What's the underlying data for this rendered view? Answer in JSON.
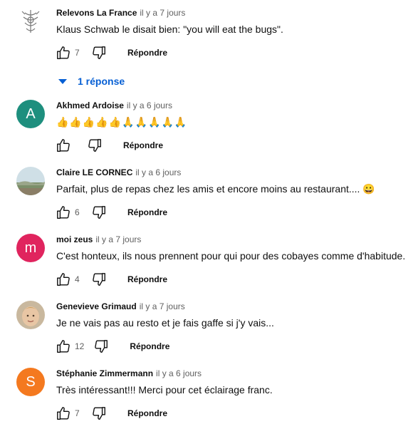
{
  "colors": {
    "link": "#065fd4",
    "avatar_a": "#1e8f7e",
    "avatar_m": "#e0245e",
    "avatar_s": "#f4791f"
  },
  "reply_label": "Répondre",
  "comments": [
    {
      "author": "Relevons La France",
      "time": "il y a 7 jours",
      "text": "Klaus Schwab le disait bien: \"you will eat the bugs\".",
      "likes": "7",
      "replies_label": "1 réponse"
    },
    {
      "author": "Akhmed Ardoise",
      "avatar_letter": "A",
      "time": "il y a 6 jours",
      "text": "👍👍👍👍👍🙏🙏🙏🙏🙏",
      "likes": ""
    },
    {
      "author": "Claire LE CORNEC",
      "time": "il y a 6 jours",
      "text": "Parfait, plus de repas chez les amis et encore moins au restaurant.... 😀",
      "likes": "6"
    },
    {
      "author": "moi zeus",
      "avatar_letter": "m",
      "time": "il y a 7 jours",
      "text": "C'est honteux, ils nous prennent pour qui pour des cobayes comme d'habitude.",
      "likes": "4"
    },
    {
      "author": "Genevieve Grimaud",
      "time": "il y a 7 jours",
      "text": "Je ne vais pas au resto et je fais gaffe si j'y vais...",
      "likes": "12"
    },
    {
      "author": "Stéphanie Zimmermann",
      "avatar_letter": "S",
      "time": "il y a 6 jours",
      "text": "Très intéressant!!! Merci pour cet éclairage franc.",
      "likes": "7"
    }
  ]
}
